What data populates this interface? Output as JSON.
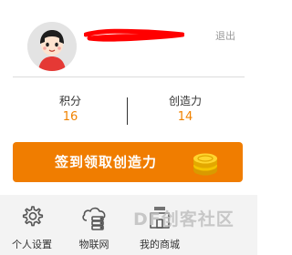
{
  "header": {
    "username": "",
    "logout_label": "退出"
  },
  "stats": {
    "points": {
      "label": "积分",
      "value": "16"
    },
    "creativity": {
      "label": "创造力",
      "value": "14"
    }
  },
  "signin": {
    "label": "签到领取创造力"
  },
  "nav": {
    "items": [
      {
        "label": "个人设置",
        "icon": "gear-icon"
      },
      {
        "label": "物联网",
        "icon": "cloud-server-icon"
      },
      {
        "label": "我的商城",
        "icon": "store-icon"
      }
    ]
  },
  "watermark": {
    "text": "DF创客社区"
  },
  "colors": {
    "accent": "#f07d00",
    "value_text": "#f08200",
    "nav_bg": "#f3f3f3",
    "redaction": "#ff0000"
  }
}
